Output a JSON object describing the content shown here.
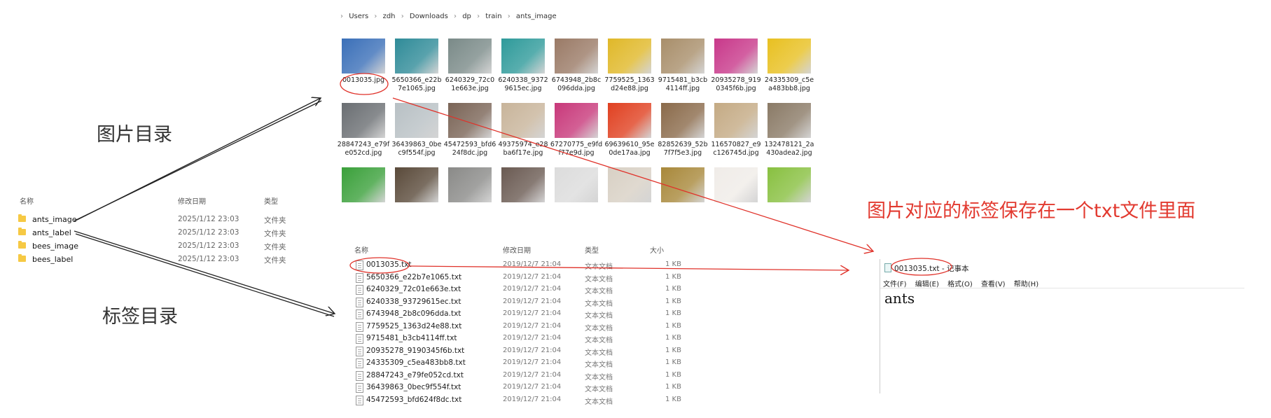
{
  "left_explorer": {
    "headers": {
      "name": "名称",
      "date": "修改日期",
      "type": "类型"
    },
    "rows": [
      {
        "name": "ants_image",
        "date": "2025/1/12 23:03",
        "type": "文件夹"
      },
      {
        "name": "ants_label",
        "date": "2025/1/12 23:03",
        "type": "文件夹"
      },
      {
        "name": "bees_image",
        "date": "2025/1/12 23:03",
        "type": "文件夹"
      },
      {
        "name": "bees_label",
        "date": "2025/1/12 23:03",
        "type": "文件夹"
      }
    ]
  },
  "labels": {
    "image_dir": "图片目录",
    "label_dir": "标签目录",
    "note": "图片对应的标签保存在一个txt文件里面"
  },
  "image_explorer": {
    "breadcrumb": [
      "Users",
      "zdh",
      "Downloads",
      "dp",
      "train",
      "ants_image"
    ],
    "thumbnails": [
      {
        "caption": "0013035.jpg",
        "color": "#3a6fb8"
      },
      {
        "caption": "5650366_e22b7e1065.jpg",
        "color": "#2f8b98"
      },
      {
        "caption": "6240329_72c01e663e.jpg",
        "color": "#7a8a88"
      },
      {
        "caption": "6240338_93729615ec.jpg",
        "color": "#2e9a9a"
      },
      {
        "caption": "6743948_2b8c096dda.jpg",
        "color": "#9a7a66"
      },
      {
        "caption": "7759525_1363d24e88.jpg",
        "color": "#e0b828"
      },
      {
        "caption": "9715481_b3cb4114ff.jpg",
        "color": "#a88e6a"
      },
      {
        "caption": "20935278_9190345f6b.jpg",
        "color": "#c8388a"
      },
      {
        "caption": "24335309_c5ea483bb8.jpg",
        "color": "#e8c020"
      },
      {
        "caption": "28847243_e79fe052cd.jpg",
        "color": "#6a6e72"
      },
      {
        "caption": "36439863_0bec9f554f.jpg",
        "color": "#b8c0c4"
      },
      {
        "caption": "45472593_bfd624f8dc.jpg",
        "color": "#7a6456"
      },
      {
        "caption": "49375974_e28ba6f17e.jpg",
        "color": "#c8b49a"
      },
      {
        "caption": "67270775_e9fdf77e9d.jpg",
        "color": "#c8387a"
      },
      {
        "caption": "69639610_95e0de17aa.jpg",
        "color": "#e04020"
      },
      {
        "caption": "82852639_52b7f7f5e3.jpg",
        "color": "#8a6a4a"
      },
      {
        "caption": "116570827_e9c126745d.jpg",
        "color": "#c4aa84"
      },
      {
        "caption": "132478121_2a430adea2.jpg",
        "color": "#8a7a66"
      },
      {
        "caption": "",
        "color": "#3aa03a"
      },
      {
        "caption": "",
        "color": "#5a4a3a"
      },
      {
        "caption": "",
        "color": "#8a8a88"
      },
      {
        "caption": "",
        "color": "#6a5a52"
      },
      {
        "caption": "",
        "color": "#dcdcdc"
      },
      {
        "caption": "",
        "color": "#d8d0c4"
      },
      {
        "caption": "",
        "color": "#a8883a"
      },
      {
        "caption": "",
        "color": "#f0ece8"
      },
      {
        "caption": "",
        "color": "#88c040"
      }
    ]
  },
  "text_explorer": {
    "headers": {
      "name": "名称",
      "date": "修改日期",
      "type": "类型",
      "size": "大小"
    },
    "rows": [
      {
        "name": "0013035.txt",
        "date": "2019/12/7 21:04",
        "type": "文本文档",
        "size": "1 KB"
      },
      {
        "name": "5650366_e22b7e1065.txt",
        "date": "2019/12/7 21:04",
        "type": "文本文档",
        "size": "1 KB"
      },
      {
        "name": "6240329_72c01e663e.txt",
        "date": "2019/12/7 21:04",
        "type": "文本文档",
        "size": "1 KB"
      },
      {
        "name": "6240338_93729615ec.txt",
        "date": "2019/12/7 21:04",
        "type": "文本文档",
        "size": "1 KB"
      },
      {
        "name": "6743948_2b8c096dda.txt",
        "date": "2019/12/7 21:04",
        "type": "文本文档",
        "size": "1 KB"
      },
      {
        "name": "7759525_1363d24e88.txt",
        "date": "2019/12/7 21:04",
        "type": "文本文档",
        "size": "1 KB"
      },
      {
        "name": "9715481_b3cb4114ff.txt",
        "date": "2019/12/7 21:04",
        "type": "文本文档",
        "size": "1 KB"
      },
      {
        "name": "20935278_9190345f6b.txt",
        "date": "2019/12/7 21:04",
        "type": "文本文档",
        "size": "1 KB"
      },
      {
        "name": "24335309_c5ea483bb8.txt",
        "date": "2019/12/7 21:04",
        "type": "文本文档",
        "size": "1 KB"
      },
      {
        "name": "28847243_e79fe052cd.txt",
        "date": "2019/12/7 21:04",
        "type": "文本文档",
        "size": "1 KB"
      },
      {
        "name": "36439863_0bec9f554f.txt",
        "date": "2019/12/7 21:04",
        "type": "文本文档",
        "size": "1 KB"
      },
      {
        "name": "45472593_bfd624f8dc.txt",
        "date": "2019/12/7 21:04",
        "type": "文本文档",
        "size": "1 KB"
      }
    ]
  },
  "notepad": {
    "title": "0013035.txt - 记事本",
    "menu": [
      "文件(F)",
      "编辑(E)",
      "格式(O)",
      "查看(V)",
      "帮助(H)"
    ],
    "content": "ants"
  },
  "colors": {
    "annotation": "#e0322a",
    "arrow": "#222222"
  }
}
